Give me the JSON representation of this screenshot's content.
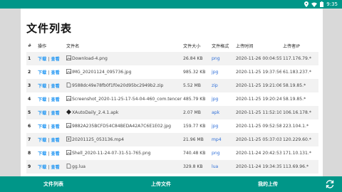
{
  "status": {
    "time": "9:35"
  },
  "page": {
    "title": "文件列表"
  },
  "columns": [
    "#",
    "操作",
    "文件名",
    "文件大小",
    "文件格式",
    "上传时间",
    "上传者IP"
  ],
  "ops": {
    "download": "下载",
    "sep": "|",
    "view": "查看"
  },
  "rows": [
    {
      "n": "1",
      "icon": "image-icon",
      "name": "Download-4.png",
      "size": "26.84 KB",
      "fmt": "png",
      "time": "2020-11-26 00:04:55",
      "ip": "117.176.79.*"
    },
    {
      "n": "2",
      "icon": "image-icon",
      "name": "IMG_20201124_095736.jpg",
      "size": "985.32 KB",
      "fmt": "jpg",
      "time": "2020-11-25 19:37:56",
      "ip": "61.183.237.*"
    },
    {
      "n": "3",
      "icon": "file-icon",
      "name": "9588dc49e78fb0f1f0e20d95bc2949b2.zip",
      "size": "5.52 MB",
      "fmt": "zip",
      "time": "2020-11-25 19:21:06",
      "ip": "58.19.85.*"
    },
    {
      "n": "4",
      "icon": "image-icon",
      "name": "Screenshot_2020-11-25-17-54-04-460_com.tencent....",
      "size": "485.79 KB",
      "fmt": "jpg",
      "time": "2020-11-25 19:20:24",
      "ip": "58.19.85.*"
    },
    {
      "n": "5",
      "icon": "app-icon",
      "name": "XAutoDaily_2.4.1.apk",
      "size": "2.07 MB",
      "fmt": "apk",
      "time": "2020-11-25 11:52:10",
      "ip": "106.16.178.*"
    },
    {
      "n": "6",
      "icon": "image-icon",
      "name": "9882A235BCFD54C84BEDA42A7C6E1E02.jpg",
      "size": "159.77 KB",
      "fmt": "jpg",
      "time": "2020-11-25 09:52:58",
      "ip": "223.104.1.*"
    },
    {
      "n": "7",
      "icon": "video-icon",
      "name": "20201125_053136.mp4",
      "size": "21.96 MB",
      "fmt": "mp4",
      "time": "2020-11-25 05:37:03",
      "ip": "120.229.60.*"
    },
    {
      "n": "8",
      "icon": "image-icon",
      "name": "Shell_2020-11-24-07-31-51-765.png",
      "size": "740.48 KB",
      "fmt": "png",
      "time": "2020-11-24 20:42:53",
      "ip": "171.10.131.*"
    },
    {
      "n": "9",
      "icon": "file-icon",
      "name": "gg.lua",
      "size": "329.8 KB",
      "fmt": "lua",
      "time": "2020-11-24 19:34:35",
      "ip": "113.69.96.*"
    },
    {
      "n": "10",
      "icon": "app-icon",
      "name": "饭团看书-1.14.19.apk",
      "size": "23.42 MB",
      "fmt": "apk",
      "time": "2020-11-24 19:07:08",
      "ip": "117.179.157.*"
    },
    {
      "n": "11",
      "icon": "video-icon",
      "name": "1606048796593.mp4",
      "size": "1.77 MB",
      "fmt": "mp4",
      "time": "2020-11-23 23:20:54",
      "ip": "218.201.184.*"
    }
  ],
  "nav": {
    "list": "文件列表",
    "upload": "上传文件",
    "mine": "我的上传"
  }
}
